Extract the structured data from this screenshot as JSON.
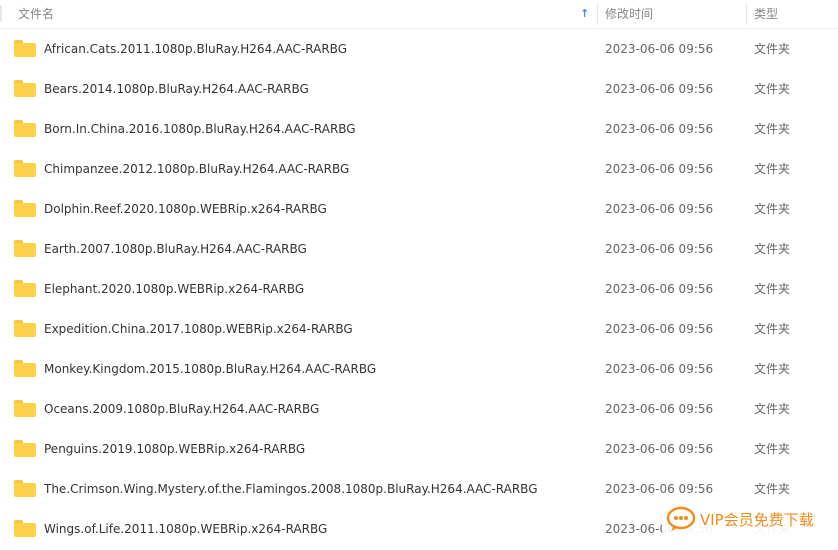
{
  "header": {
    "name_label": "文件名",
    "sort_icon": "arrow-up-icon",
    "mtime_label": "修改时间",
    "type_label": "类型"
  },
  "files": [
    {
      "name": "African.Cats.2011.1080p.BluRay.H264.AAC-RARBG",
      "date": "2023-06-06 09:56",
      "type": "文件夹"
    },
    {
      "name": "Bears.2014.1080p.BluRay.H264.AAC-RARBG",
      "date": "2023-06-06 09:56",
      "type": "文件夹"
    },
    {
      "name": "Born.In.China.2016.1080p.BluRay.H264.AAC-RARBG",
      "date": "2023-06-06 09:56",
      "type": "文件夹"
    },
    {
      "name": "Chimpanzee.2012.1080p.BluRay.H264.AAC-RARBG",
      "date": "2023-06-06 09:56",
      "type": "文件夹"
    },
    {
      "name": "Dolphin.Reef.2020.1080p.WEBRip.x264-RARBG",
      "date": "2023-06-06 09:56",
      "type": "文件夹"
    },
    {
      "name": "Earth.2007.1080p.BluRay.H264.AAC-RARBG",
      "date": "2023-06-06 09:56",
      "type": "文件夹"
    },
    {
      "name": "Elephant.2020.1080p.WEBRip.x264-RARBG",
      "date": "2023-06-06 09:56",
      "type": "文件夹"
    },
    {
      "name": "Expedition.China.2017.1080p.WEBRip.x264-RARBG",
      "date": "2023-06-06 09:56",
      "type": "文件夹"
    },
    {
      "name": "Monkey.Kingdom.2015.1080p.BluRay.H264.AAC-RARBG",
      "date": "2023-06-06 09:56",
      "type": "文件夹"
    },
    {
      "name": "Oceans.2009.1080p.BluRay.H264.AAC-RARBG",
      "date": "2023-06-06 09:56",
      "type": "文件夹"
    },
    {
      "name": "Penguins.2019.1080p.WEBRip.x264-RARBG",
      "date": "2023-06-06 09:56",
      "type": "文件夹"
    },
    {
      "name": "The.Crimson.Wing.Mystery.of.the.Flamingos.2008.1080p.BluRay.H264.AAC-RARBG",
      "date": "2023-06-06 09:56",
      "type": "文件夹"
    },
    {
      "name": "Wings.of.Life.2011.1080p.WEBRip.x264-RARBG",
      "date": "2023-06-06 09:56",
      "type": "文件夹"
    }
  ],
  "file_icon": "folder-icon",
  "watermark": {
    "text": "VIP会员免费下载",
    "icon": "chat-bubble-logo-icon"
  },
  "colors": {
    "folder": "#ffd04a",
    "sort_arrow": "#3b8cff",
    "watermark": "#f08c1b"
  }
}
